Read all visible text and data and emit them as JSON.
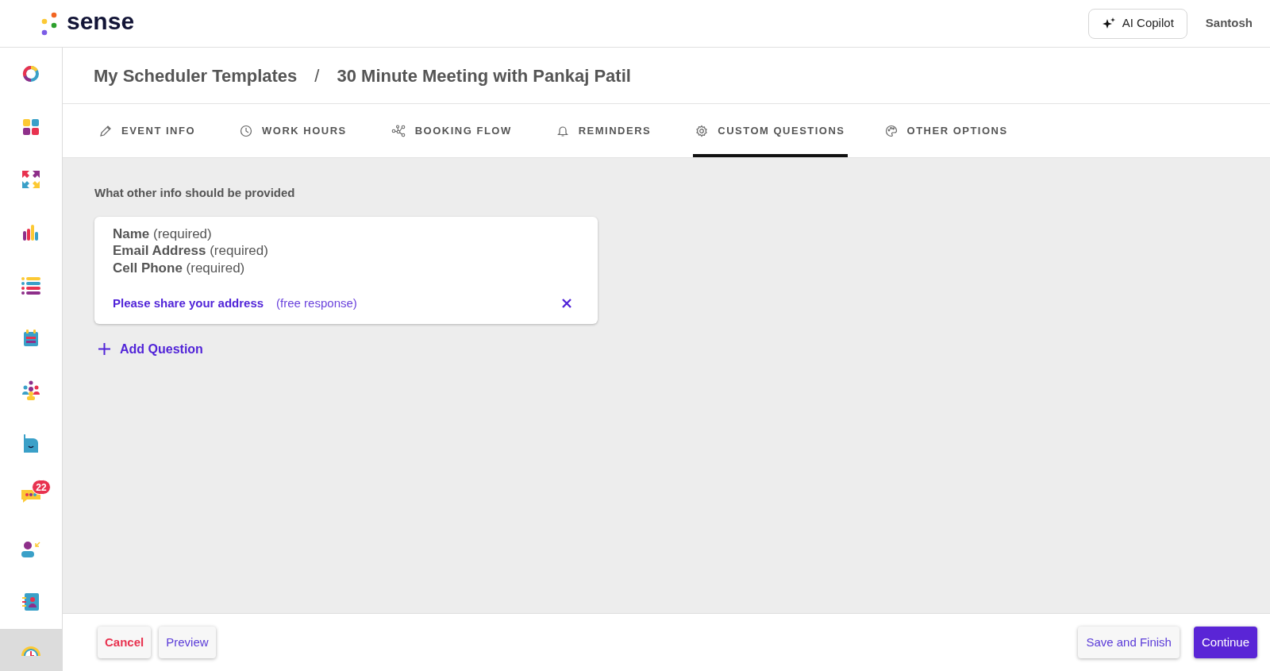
{
  "header": {
    "logo": "sense",
    "copilot_button": "AI Copilot",
    "user": "Santosh"
  },
  "sidebar": {
    "items": [
      {
        "selected": false
      },
      {
        "selected": false
      },
      {
        "selected": false
      },
      {
        "selected": false
      },
      {
        "selected": false
      },
      {
        "selected": false
      },
      {
        "selected": false
      },
      {
        "selected": false
      },
      {
        "selected": false,
        "badge": "22"
      },
      {
        "selected": false
      },
      {
        "selected": false
      },
      {
        "selected": true
      }
    ]
  },
  "breadcrumb": [
    "My Scheduler Templates",
    "/",
    "30 Minute Meeting with Pankaj Patil"
  ],
  "tabs": [
    {
      "label": "EVENT INFO",
      "selected": false
    },
    {
      "label": "WORK HOURS",
      "selected": false
    },
    {
      "label": "BOOKING FLOW",
      "selected": false
    },
    {
      "label": "REMINDERS",
      "selected": false
    },
    {
      "label": "CUSTOM QUESTIONS",
      "selected": true
    },
    {
      "label": "OTHER OPTIONS",
      "selected": false
    }
  ],
  "section_label": "What other info should be provided",
  "required_fields": [
    {
      "name": "Name",
      "note": "(required)"
    },
    {
      "name": "Email Address",
      "note": "(required)"
    },
    {
      "name": "Cell Phone",
      "note": "(required)"
    }
  ],
  "custom_questions": [
    {
      "text": "Please share your address",
      "type": "(free response)"
    }
  ],
  "add_question": "Add Question",
  "footer_buttons": [
    {
      "label": "Cancel",
      "kind": "cancel"
    },
    {
      "label": "Preview",
      "kind": "preview"
    },
    {
      "label": "Save and Finish",
      "kind": "save"
    },
    {
      "label": "Continue",
      "kind": "primary"
    }
  ]
}
